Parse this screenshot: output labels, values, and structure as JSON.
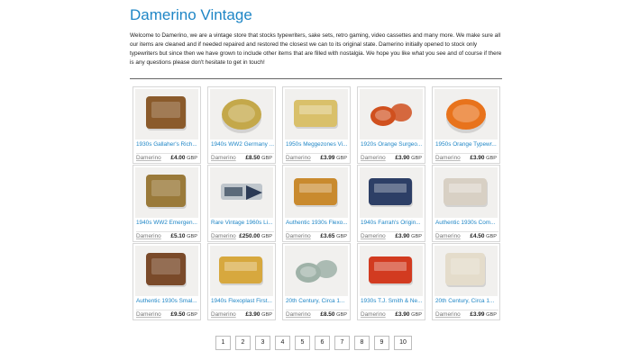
{
  "header": {
    "title": "Damerino Vintage",
    "intro": "Welcome to Damerino, we are a vintage store that stocks typewriters, sake sets, retro gaming, video cassettes and many more. We make sure all our items are cleaned and if needed repaired and restored the closest we can to its original state. Damerino initially opened to stock only typewriters but since then we have grown to include other items that are filled with nostalgia. We hope you like what you see and of course if there is any questions please don't hesitate to get in touch!"
  },
  "products": [
    {
      "title": "1930s Gallaher's Rich...",
      "seller": "Damerino",
      "price": "£4.00",
      "currency": "GBP",
      "tin_color": "#8a5a2b",
      "tin_shape": "rect-tall"
    },
    {
      "title": "1940s WW2 Germany ...",
      "seller": "Damerino",
      "price": "£8.50",
      "currency": "GBP",
      "tin_color": "#c4a84a",
      "tin_shape": "oval"
    },
    {
      "title": "1950s Meggezones Vi...",
      "seller": "Damerino",
      "price": "£3.99",
      "currency": "GBP",
      "tin_color": "#d9c06a",
      "tin_shape": "rect"
    },
    {
      "title": "1920s Orange Surgeo...",
      "seller": "Damerino",
      "price": "£3.90",
      "currency": "GBP",
      "tin_color": "#d0501e",
      "tin_shape": "round-pair"
    },
    {
      "title": "1950s Orange Typewr...",
      "seller": "Damerino",
      "price": "£3.90",
      "currency": "GBP",
      "tin_color": "#e8731c",
      "tin_shape": "round"
    },
    {
      "title": "1940s WW2 Emergen...",
      "seller": "Damerino",
      "price": "£5.10",
      "currency": "GBP",
      "tin_color": "#9a7a3a",
      "tin_shape": "rect-tall"
    },
    {
      "title": "Rare Vintage 1960s Li...",
      "seller": "Damerino",
      "price": "£250.00",
      "currency": "GBP",
      "tin_color": "#5b6a7a",
      "tin_shape": "tool"
    },
    {
      "title": "Authentic 1930s Flexo...",
      "seller": "Damerino",
      "price": "£3.65",
      "currency": "GBP",
      "tin_color": "#c98a2e",
      "tin_shape": "rect"
    },
    {
      "title": "1940s Farrah's Origin...",
      "seller": "Damerino",
      "price": "£3.90",
      "currency": "GBP",
      "tin_color": "#2d3f66",
      "tin_shape": "rect"
    },
    {
      "title": "Authentic 1930s Com...",
      "seller": "Damerino",
      "price": "£4.50",
      "currency": "GBP",
      "tin_color": "#d8d0c4",
      "tin_shape": "rect"
    },
    {
      "title": "Authentic 1930s Smal...",
      "seller": "Damerino",
      "price": "£9.50",
      "currency": "GBP",
      "tin_color": "#7a4a2a",
      "tin_shape": "rect-tall"
    },
    {
      "title": "1940s Flexoplast First...",
      "seller": "Damerino",
      "price": "£3.90",
      "currency": "GBP",
      "tin_color": "#d7a83e",
      "tin_shape": "rect"
    },
    {
      "title": "20th Century, Circa 1...",
      "seller": "Damerino",
      "price": "£8.50",
      "currency": "GBP",
      "tin_color": "#9fb2a8",
      "tin_shape": "round-pair"
    },
    {
      "title": "1930s T.J. Smith & Ne...",
      "seller": "Damerino",
      "price": "£3.90",
      "currency": "GBP",
      "tin_color": "#d23b20",
      "tin_shape": "rect"
    },
    {
      "title": "20th Century, Circa 1...",
      "seller": "Damerino",
      "price": "£3.99",
      "currency": "GBP",
      "tin_color": "#e4dccb",
      "tin_shape": "rect-tall"
    }
  ],
  "pagination": [
    "1",
    "2",
    "3",
    "4",
    "5",
    "6",
    "7",
    "8",
    "9",
    "10"
  ]
}
